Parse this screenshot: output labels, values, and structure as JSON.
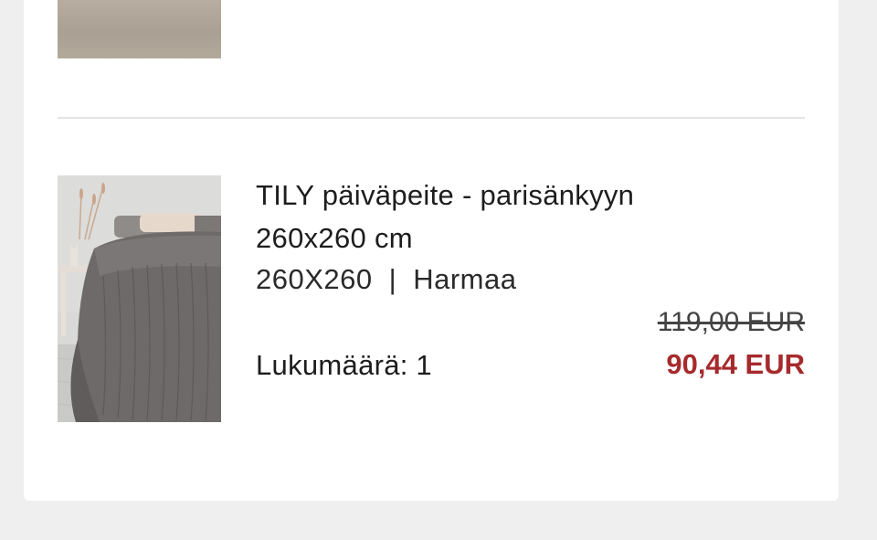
{
  "cart_item": {
    "title": "TILY päiväpeite - parisänkyyn 260x260 cm",
    "size": "260X260",
    "separator": "|",
    "color": "Harmaa",
    "quantity_label": "Lukumäärä:",
    "quantity_value": "1",
    "original_price": "119,00 EUR",
    "sale_price": "90,44 EUR"
  },
  "colors": {
    "sale_price": "#a62a2c",
    "page_background": "#efefef",
    "card_background": "#ffffff"
  }
}
